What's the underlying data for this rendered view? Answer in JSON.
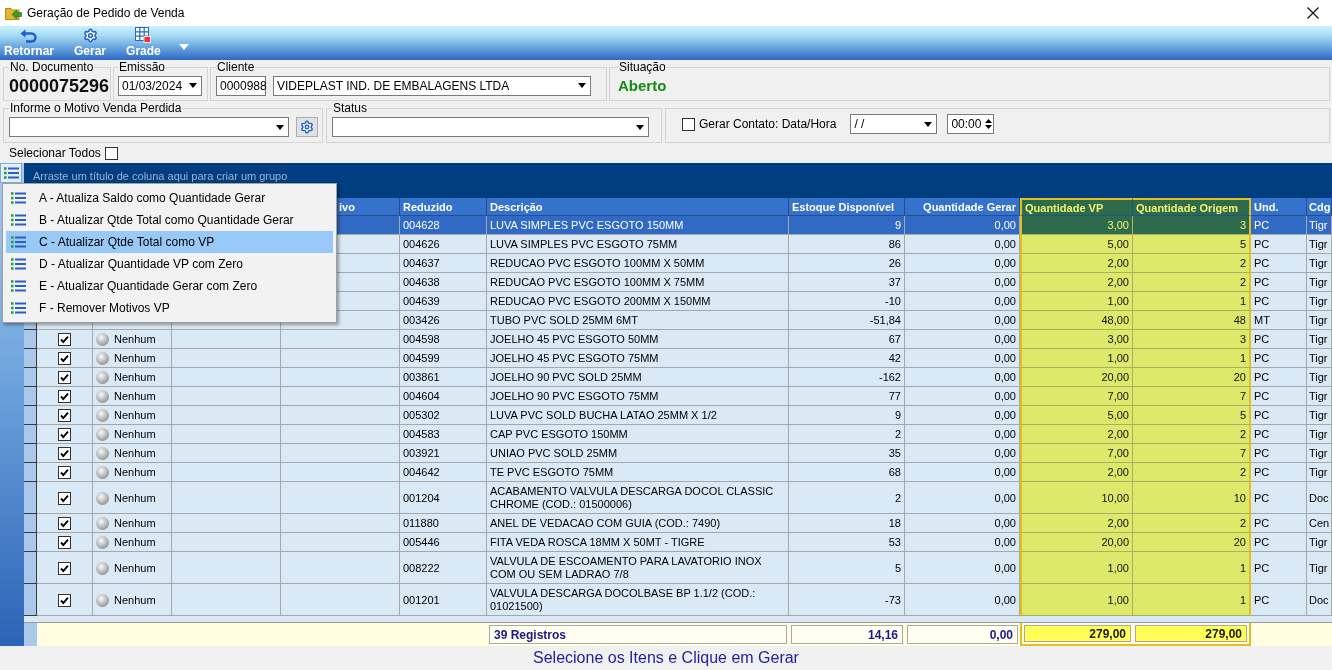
{
  "window": {
    "title": "Geração de Pedido de Venda"
  },
  "toolbar": {
    "buttons": [
      {
        "label": "Retornar",
        "kind": "undo"
      },
      {
        "label": "Gerar",
        "kind": "gear"
      },
      {
        "label": "Grade",
        "kind": "grid"
      }
    ]
  },
  "header": {
    "document": {
      "label": "No. Documento",
      "value": "0000075296"
    },
    "emission": {
      "label": "Emissão",
      "value": "01/03/2024"
    },
    "client": {
      "label": "Cliente",
      "code": "0000988",
      "name": "VIDEPLAST IND. DE EMBALAGENS LTDA"
    },
    "situation": {
      "label": "Situação",
      "value": "Aberto"
    }
  },
  "filters": {
    "lost_sale_reason": {
      "label": "Informe o Motivo Venda Perdida"
    },
    "status": {
      "label": "Status"
    },
    "contact": {
      "label": "Gerar Contato: Data/Hora",
      "checked": false,
      "date": "/ /",
      "time": "00:00"
    }
  },
  "select_all": {
    "label": "Selecionar Todos",
    "checked": false
  },
  "table": {
    "group_hint": "Arraste um título de coluna aqui para criar um grupo",
    "columns": [
      {
        "label": "ivo",
        "highlighted": false
      },
      {
        "label": "Reduzido",
        "highlighted": false
      },
      {
        "label": "Descrição",
        "highlighted": false
      },
      {
        "label": "Estoque Disponível",
        "highlighted": false
      },
      {
        "label": "Quantidade Gerar",
        "highlighted": false
      },
      {
        "label": "Quantidade VP",
        "highlighted": true
      },
      {
        "label": "Quantidade Origem",
        "highlighted": true
      },
      {
        "label": "Und.",
        "highlighted": false
      },
      {
        "label": "Cdg",
        "highlighted": false
      }
    ],
    "rows": [
      {
        "selected": true,
        "values": [
          "004628",
          "LUVA SIMPLES PVC ESGOTO 150MM",
          "9",
          "0,00",
          "3,00",
          "3",
          "PC",
          "Tigr"
        ]
      },
      {
        "selected": false,
        "values": [
          "004626",
          "LUVA SIMPLES PVC ESGOTO 75MM",
          "86",
          "0,00",
          "5,00",
          "5",
          "PC",
          "Tigr"
        ]
      },
      {
        "selected": false,
        "values": [
          "004637",
          "REDUCAO PVC ESGOTO 100MM X 50MM",
          "26",
          "0,00",
          "2,00",
          "2",
          "PC",
          "Tigr"
        ]
      },
      {
        "selected": false,
        "values": [
          "004638",
          "REDUCAO PVC ESGOTO 100MM X 75MM",
          "37",
          "0,00",
          "2,00",
          "2",
          "PC",
          "Tigr"
        ]
      },
      {
        "selected": false,
        "values": [
          "004639",
          "REDUCAO PVC ESGOTO 200MM X 150MM",
          "-10",
          "0,00",
          "1,00",
          "1",
          "PC",
          "Tigr"
        ]
      },
      {
        "selected": false,
        "values": [
          "003426",
          "TUBO PVC SOLD 25MM 6MT",
          "-51,84",
          "0,00",
          "48,00",
          "48",
          "MT",
          "Tigr"
        ]
      },
      {
        "selected": false,
        "checked": true,
        "status": "Nenhum",
        "values": [
          "004598",
          "JOELHO 45 PVC ESGOTO 50MM",
          "67",
          "0,00",
          "3,00",
          "3",
          "PC",
          "Tigr"
        ]
      },
      {
        "selected": false,
        "checked": true,
        "status": "Nenhum",
        "values": [
          "004599",
          "JOELHO 45 PVC ESGOTO 75MM",
          "42",
          "0,00",
          "1,00",
          "1",
          "PC",
          "Tigr"
        ]
      },
      {
        "selected": false,
        "checked": true,
        "status": "Nenhum",
        "values": [
          "003861",
          "JOELHO 90 PVC SOLD 25MM",
          "-162",
          "0,00",
          "20,00",
          "20",
          "PC",
          "Tigr"
        ]
      },
      {
        "selected": false,
        "checked": true,
        "status": "Nenhum",
        "values": [
          "004604",
          "JOELHO 90 PVC ESGOTO 75MM",
          "77",
          "0,00",
          "7,00",
          "7",
          "PC",
          "Tigr"
        ]
      },
      {
        "selected": false,
        "checked": true,
        "status": "Nenhum",
        "values": [
          "005302",
          "LUVA PVC SOLD BUCHA LATAO 25MM X 1/2",
          "9",
          "0,00",
          "5,00",
          "5",
          "PC",
          "Tigr"
        ]
      },
      {
        "selected": false,
        "checked": true,
        "status": "Nenhum",
        "values": [
          "004583",
          "CAP PVC ESGOTO 150MM",
          "2",
          "0,00",
          "2,00",
          "2",
          "PC",
          "Tigr"
        ]
      },
      {
        "selected": false,
        "checked": true,
        "status": "Nenhum",
        "values": [
          "003921",
          "UNIAO PVC SOLD 25MM",
          "35",
          "0,00",
          "7,00",
          "7",
          "PC",
          "Tigr"
        ]
      },
      {
        "selected": false,
        "checked": true,
        "status": "Nenhum",
        "values": [
          "004642",
          "TE PVC ESGOTO 75MM",
          "68",
          "0,00",
          "2,00",
          "2",
          "PC",
          "Tigr"
        ]
      },
      {
        "selected": false,
        "checked": true,
        "status": "Nenhum",
        "values": [
          "001204",
          "ACABAMENTO VALVULA DESCARGA DOCOL CLASSIC CHROME (COD.: 01500006)",
          "2",
          "0,00",
          "10,00",
          "10",
          "PC",
          "Doc"
        ]
      },
      {
        "selected": false,
        "checked": true,
        "status": "Nenhum",
        "values": [
          "011880",
          "ANEL DE VEDACAO COM GUIA (COD.: 7490)",
          "18",
          "0,00",
          "2,00",
          "2",
          "PC",
          "Cen"
        ]
      },
      {
        "selected": false,
        "checked": true,
        "status": "Nenhum",
        "values": [
          "005446",
          "FITA VEDA ROSCA 18MM X 50MT - TIGRE",
          "53",
          "0,00",
          "20,00",
          "20",
          "PC",
          "Tigr"
        ]
      },
      {
        "selected": false,
        "checked": true,
        "status": "Nenhum",
        "values": [
          "008222",
          "VALVULA DE ESCOAMENTO PARA LAVATORIO INOX COM OU SEM LADRAO 7/8",
          "5",
          "0,00",
          "1,00",
          "1",
          "PC",
          "Tigr"
        ]
      },
      {
        "selected": false,
        "checked": true,
        "status": "Nenhum",
        "values": [
          "001201",
          "VALVULA DESCARGA DOCOLBASE BP 1.1/2 (COD.: 01021500)",
          "-73",
          "0,00",
          "1,00",
          "1",
          "PC",
          "Doc"
        ]
      }
    ],
    "footer": {
      "record_count": "39 Registros",
      "totals": [
        "14,16",
        "0,00",
        "279,00",
        "279,00"
      ]
    }
  },
  "context_menu": {
    "items": [
      {
        "label": "A - Atualiza Saldo como Quantidade Gerar",
        "selected": false
      },
      {
        "label": "B - Atualizar Qtde Total como Quantidade Gerar",
        "selected": false
      },
      {
        "label": "C - Atualizar Qtde Total como VP",
        "selected": true
      },
      {
        "label": "D - Atualizar Quantidade VP com Zero",
        "selected": false
      },
      {
        "label": "E - Atualizar Quantidade Gerar com Zero",
        "selected": false
      },
      {
        "label": "F - Remover Motivos VP",
        "selected": false
      }
    ]
  },
  "status_bar": {
    "text": "Selecione os Itens e Clique em Gerar"
  }
}
